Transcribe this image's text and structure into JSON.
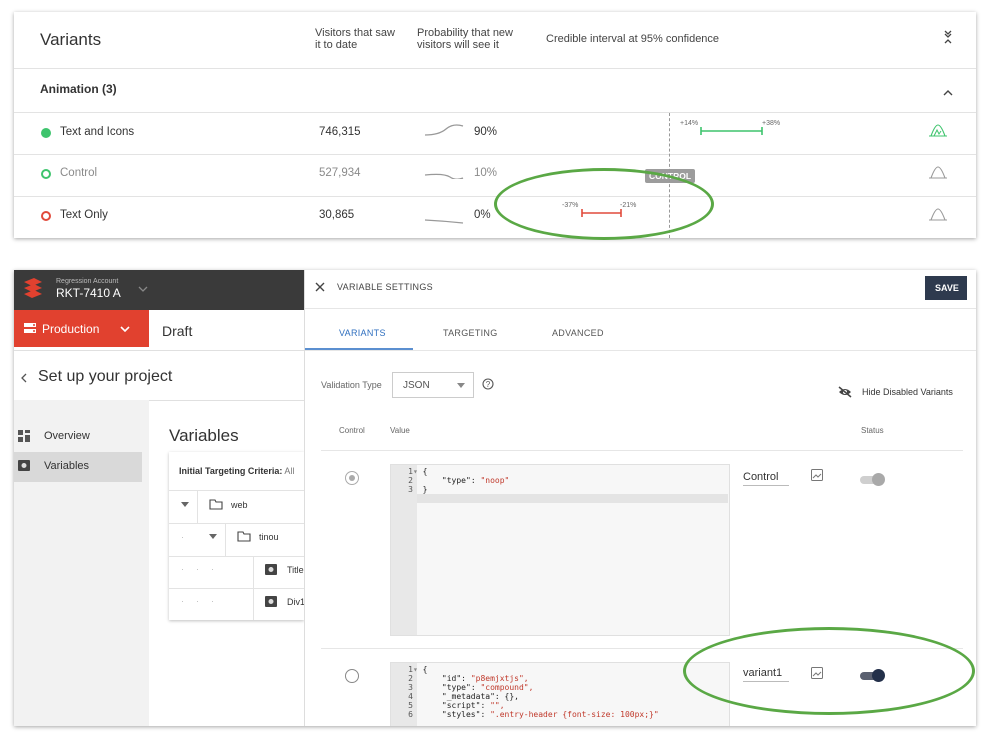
{
  "results": {
    "title": "Variants",
    "col_visitors": [
      "Visitors that saw",
      "it to date"
    ],
    "col_probability": [
      "Probability that new",
      "visitors will see it"
    ],
    "col_interval": "Credible interval at 95% confidence",
    "group_label": "Animation (3)",
    "rows": [
      {
        "name": "Text and Icons",
        "visitors": "746,315",
        "probability": "90%",
        "low": "+14%",
        "high": "+38%"
      },
      {
        "name": "Control",
        "visitors": "527,934",
        "probability": "10%",
        "badge": "CONTROL"
      },
      {
        "name": "Text Only",
        "visitors": "30,865",
        "probability": "0%",
        "low": "-37%",
        "high": "-21%"
      }
    ]
  },
  "account": {
    "label": "Regression Account",
    "name": "RKT-7410 A"
  },
  "environment": {
    "button": "Production",
    "draft": "Draft"
  },
  "project": {
    "title": "Set up your project"
  },
  "nav": [
    {
      "label": "Overview"
    },
    {
      "label": "Variables"
    }
  ],
  "variables": {
    "title": "Variables",
    "criteria": "Initial Targeting Criteria:",
    "criteria_value": "All",
    "tree": [
      "web",
      "tinou",
      "Title",
      "Div1"
    ]
  },
  "settings": {
    "header": "VARIABLE SETTINGS",
    "save": "SAVE",
    "tabs": [
      "VARIANTS",
      "TARGETING",
      "ADVANCED"
    ],
    "validation_label": "Validation Type",
    "validation_value": "JSON",
    "hide_disabled": "Hide Disabled Variants",
    "col_control": "Control",
    "col_value": "Value",
    "col_status": "Status",
    "variant1": {
      "name": "Control",
      "lines": [
        {
          "n": "1",
          "text": "{"
        },
        {
          "n": "2",
          "key": "\"type\"",
          "val": "\"noop\""
        },
        {
          "n": "3",
          "text": "}"
        }
      ]
    },
    "variant2": {
      "name": "variant1",
      "lines": [
        {
          "n": "1",
          "text": "{"
        },
        {
          "n": "2",
          "key": "\"id\"",
          "val": "\"p8emjxtjs\","
        },
        {
          "n": "3",
          "key": "\"type\"",
          "val": "\"compound\","
        },
        {
          "n": "4",
          "key": "\"_metadata\"",
          "plain": "{},"
        },
        {
          "n": "5",
          "key": "\"script\"",
          "val": "\"\","
        },
        {
          "n": "6",
          "key": "\"styles\"",
          "val": "\".entry-header {font-size: 100px;}\""
        }
      ]
    }
  },
  "colors": {
    "green": "#3ec46d",
    "red": "#e14a3b",
    "accent": "#2f6fbf",
    "annotation": "#5aa845"
  }
}
